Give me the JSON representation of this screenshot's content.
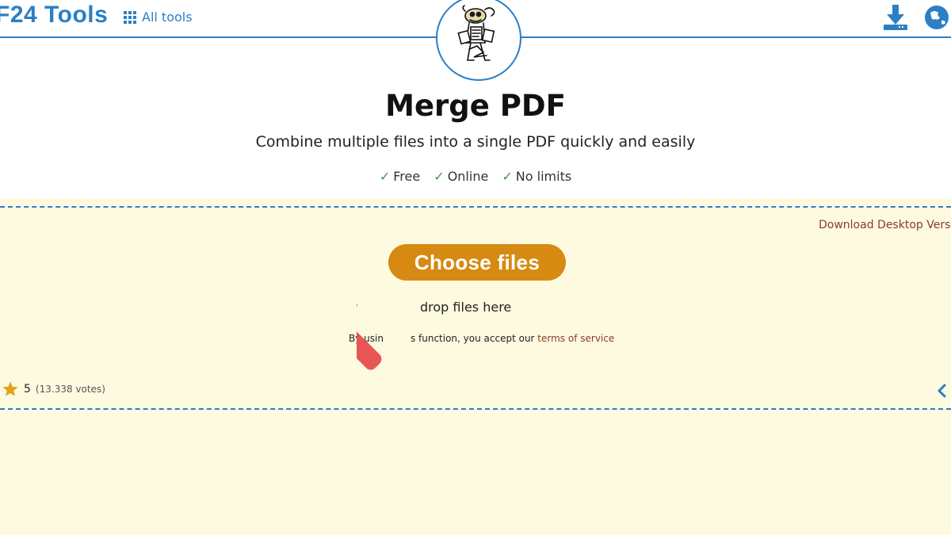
{
  "header": {
    "brand": "F24 Tools",
    "all_tools_label": "All tools",
    "icons": [
      "grid-icon",
      "download-icon",
      "language-icon",
      "mascot-logo"
    ]
  },
  "main": {
    "title": "Merge PDF",
    "subtitle": "Combine multiple files into a single PDF quickly and easily",
    "features": [
      {
        "check": "✓",
        "label": "Free"
      },
      {
        "check": "✓",
        "label": "Online"
      },
      {
        "check": "✓",
        "label": "No limits"
      }
    ]
  },
  "upload": {
    "desktop_link": "Download Desktop Versi",
    "choose_button": "Choose files",
    "drop_text": "drop files here",
    "terms_prefix": "By usin",
    "terms_middle": "s function, you accept our ",
    "terms_link": "terms of service"
  },
  "rating": {
    "score": "5",
    "votes": "(13.338 votes)"
  },
  "colors": {
    "brand_blue": "#2b7fc4",
    "button_orange": "#d68a12",
    "dropzone_bg": "#fdfae0",
    "arrow_red": "#e85555",
    "check_green": "#3a9a3a",
    "link_brown": "#8a3b2b"
  }
}
